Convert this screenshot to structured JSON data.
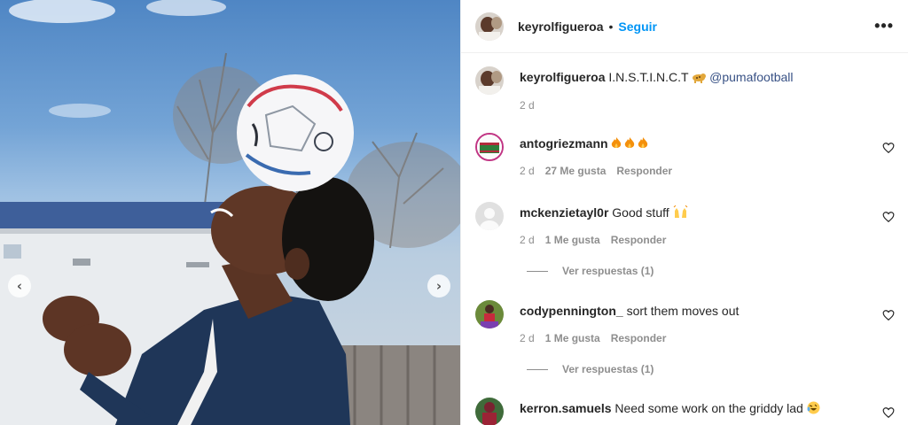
{
  "post": {
    "author": "keyrolfigueroa",
    "separator": "•",
    "follow_label": "Seguir",
    "more_label": "•••",
    "caption_text": "I.N.S.T.I.N.C.T",
    "caption_mention": "@pumafootball",
    "caption_age": "2 d"
  },
  "carousel": {
    "prev_label": "‹",
    "next_label": "›"
  },
  "comments": [
    {
      "user": "antogriezmann",
      "text": "",
      "age": "2 d",
      "likes": "27 Me gusta",
      "reply": "Responder",
      "replies": ""
    },
    {
      "user": "mckenzietayl0r",
      "text": "Good stuff",
      "age": "2 d",
      "likes": "1 Me gusta",
      "reply": "Responder",
      "replies": "Ver respuestas (1)"
    },
    {
      "user": "codypennington_",
      "text": "sort them moves out",
      "age": "2 d",
      "likes": "1 Me gusta",
      "reply": "Responder",
      "replies": "Ver respuestas (1)"
    },
    {
      "user": "kerron.samuels",
      "text": "Need some work on the griddy lad",
      "age": "",
      "likes": "",
      "reply": "",
      "replies": ""
    }
  ],
  "colors": {
    "link": "#0095f6",
    "mention": "#385185",
    "muted": "#8e8e8e",
    "text": "#262626"
  },
  "icons": {
    "heart": "heart-outline-icon",
    "more": "more-horizontal-icon",
    "prev": "chevron-left-icon",
    "next": "chevron-right-icon"
  }
}
